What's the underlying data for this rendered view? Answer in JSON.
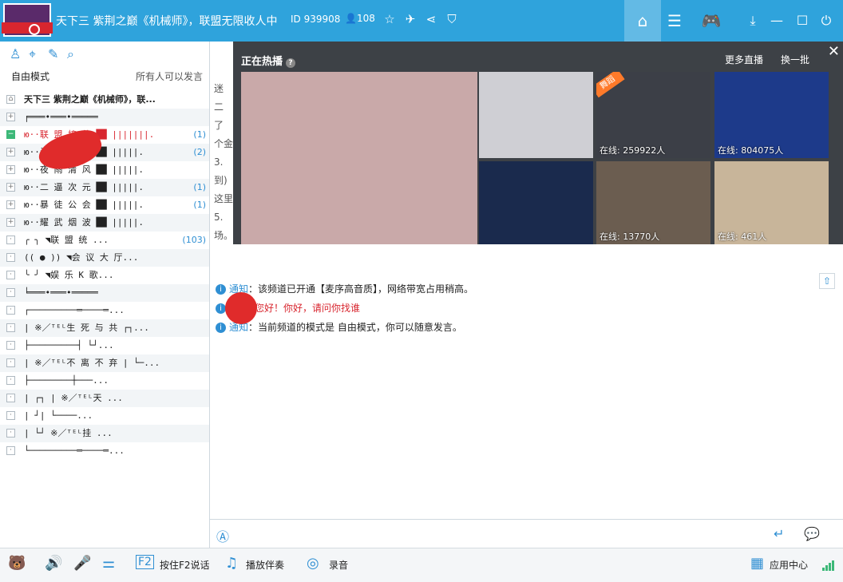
{
  "header": {
    "title": "天下三 紫荆之巅《机械师》，联盟无限收人中",
    "id_label": "ID 939908",
    "user_count": "108"
  },
  "left": {
    "mode_label": "自由模式",
    "speak_label": "所有人可以发言",
    "tree": [
      {
        "text": "天下三 紫荆之巅《机械师》，联...",
        "count": "",
        "style": "bold"
      },
      {
        "text": "╒═══•═══•═════",
        "count": "",
        "style": ""
      },
      {
        "text": "ю··联 盟 接 待  ██ |||||||.",
        "count": "(1)",
        "style": "red"
      },
      {
        "text": "ю··杀 戮 军 团  ██ |||||.",
        "count": "(2)",
        "style": ""
      },
      {
        "text": "ю··夜 雨 清 风  ██ |||||.",
        "count": "",
        "style": ""
      },
      {
        "text": "ю··二 逼 次 元  ██ |||||.",
        "count": "(1)",
        "style": ""
      },
      {
        "text": "ю··暴 徒 公 会  ██ |||||.",
        "count": "(1)",
        "style": ""
      },
      {
        "text": "ю··耀 武 烟 波  ██ |||||.",
        "count": "",
        "style": ""
      },
      {
        "text": "  ╭ ╮    ◥联 盟 统 ...",
        "count": "(103)",
        "style": ""
      },
      {
        "text": "(( ● ))  ◥会 议 大 厅...",
        "count": "",
        "style": ""
      },
      {
        "text": "  ╰ ╯    ◥娱 乐 K 歌...",
        "count": "",
        "style": ""
      },
      {
        "text": "╘═══•═══•═════",
        "count": "",
        "style": ""
      },
      {
        "text": "┌─────────═────═...",
        "count": "",
        "style": ""
      },
      {
        "text": "| ※／ᵀᴱᴸ生 死 与 共    ┌┐...",
        "count": "",
        "style": ""
      },
      {
        "text": "├─────────┤  └┘...",
        "count": "",
        "style": ""
      },
      {
        "text": "| ※／ᵀᴱᴸ不 离 不 弃 |  └─...",
        "count": "",
        "style": ""
      },
      {
        "text": "├────────┼───...",
        "count": "",
        "style": ""
      },
      {
        "text": "|      ┌┐    | ※／ᵀᴱᴸ天  ...",
        "count": "",
        "style": ""
      },
      {
        "text": "|     ┘|    └────...",
        "count": "",
        "style": ""
      },
      {
        "text": "|     └┘       ※／ᵀᴱᴸ挂  ...",
        "count": "",
        "style": ""
      },
      {
        "text": "└─────────═────═...",
        "count": "",
        "style": ""
      }
    ]
  },
  "hot": {
    "title": "正在热播",
    "more": "更多直播",
    "refresh": "换一批",
    "thumbs": [
      {
        "online": "",
        "color": "#c9a9a9"
      },
      {
        "online": "",
        "color": "#cfcfd4"
      },
      {
        "online": "在线: 259922人",
        "color": "#3c3f47",
        "tag": "舞蹈"
      },
      {
        "online": "在线: 804075人",
        "color": "#1d3a8a"
      },
      {
        "online": "",
        "color": "#1a2a4d"
      },
      {
        "online": "在线: 13770人",
        "color": "#6b5d50"
      },
      {
        "online": "在线: 461人",
        "color": "#c8b59a"
      }
    ]
  },
  "main": {
    "bg_lines": [
      "迷",
      "二",
      "了",
      "个金",
      "3.",
      "到)",
      "这里",
      "5.",
      "场。"
    ],
    "messages": [
      {
        "label": "通知",
        "text": "：该频道已开通【麦序高音质】，网络带宽占用稍高。",
        "red": ""
      },
      {
        "label": "",
        "text": "",
        "red": "您好！你好，请问你找谁"
      },
      {
        "label": "通知",
        "text": "：当前频道的模式是 自由模式，你可以随意发言。",
        "red": ""
      }
    ]
  },
  "bottom": {
    "f2": "按住F2说话",
    "accompany": "播放伴奏",
    "record": "录音",
    "app_center": "应用中心"
  }
}
